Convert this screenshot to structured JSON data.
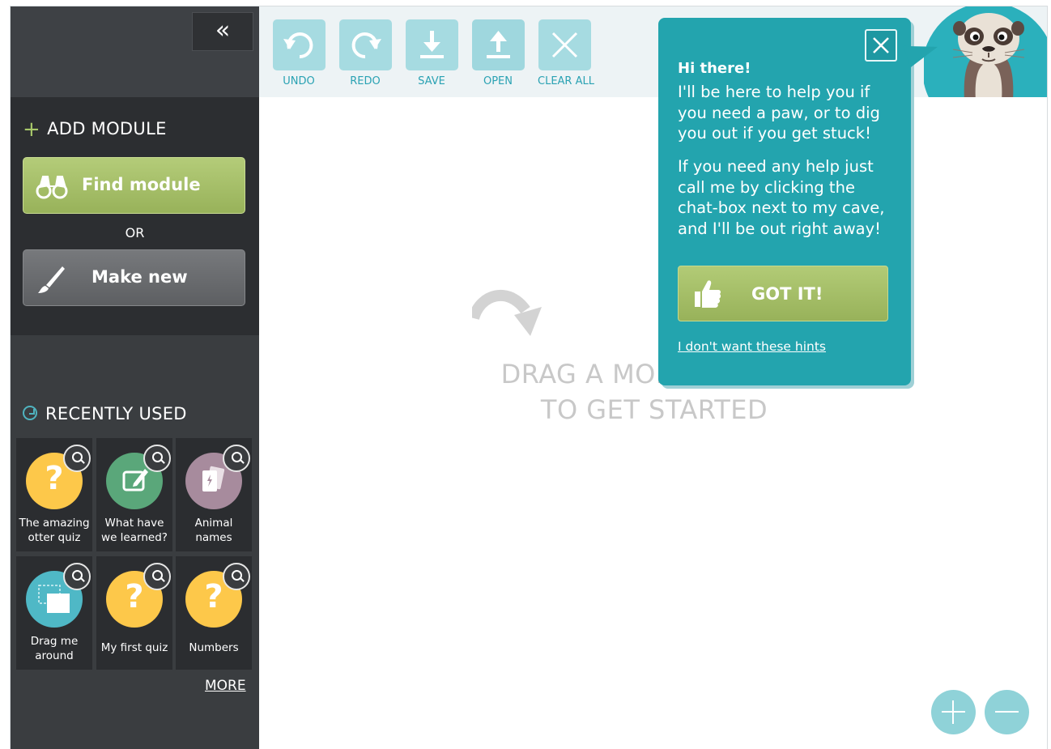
{
  "sidebar": {
    "collapse_label": "«",
    "add_module": {
      "title": "ADD MODULE",
      "find_label": "Find module",
      "or_text": "OR",
      "make_label": "Make new"
    },
    "recent": {
      "title": "RECENTLY USED",
      "items": [
        {
          "name": "The amazing otter quiz",
          "icon": "question-icon",
          "color": "#fdc84a"
        },
        {
          "name": "What have we learned?",
          "icon": "edit-icon",
          "color": "#5aa77a"
        },
        {
          "name": "Animal names",
          "icon": "flashcards-icon",
          "color": "#a78b9d"
        },
        {
          "name": "Drag me around",
          "icon": "drag-icon",
          "color": "#4fb8c6"
        },
        {
          "name": "My first quiz",
          "icon": "question-icon",
          "color": "#fdc84a"
        },
        {
          "name": "Numbers",
          "icon": "question-icon",
          "color": "#fdc84a"
        }
      ],
      "more_label": "MORE"
    }
  },
  "toolbar": {
    "undo": "UNDO",
    "redo": "REDO",
    "save": "SAVE",
    "open": "OPEN",
    "clear": "CLEAR ALL"
  },
  "canvas": {
    "drop_line1": "DRAG A MODULE HERE",
    "drop_line2": "TO GET STARTED"
  },
  "hint": {
    "title": "Hi there!",
    "p1": "I'll be here to help you if you need a paw, or to dig you out if you get stuck!",
    "p2": "If you need any help just call me by clicking the chat-box next to my cave, and I'll be out right away!",
    "button": "GOT IT!",
    "no_hints": "I don't want these hints"
  },
  "colors": {
    "accent_green": "#a8c46a",
    "teal": "#23a4ae",
    "sidebar": "#3a3d40"
  }
}
